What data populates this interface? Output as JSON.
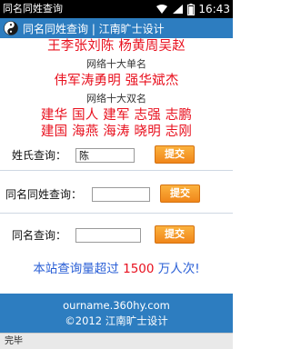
{
  "statusbar": {
    "app_title": "同名同姓查询",
    "time": "16:43",
    "icons": [
      "wifi-icon",
      "signal-icon",
      "battery-icon"
    ]
  },
  "header": {
    "logo_icon": "yin-yang-icon",
    "title": "同名同姓查询 | 江南旷士设计"
  },
  "names": {
    "top_single_partial": "王李张刘陈 杨黄周吴赵",
    "single_label": "网络十大单名",
    "single_names": "伟军涛勇明 强华斌杰",
    "double_label": "网络十大双名",
    "double_line1": "建华 国人 建军 志强 志鹏",
    "double_line2": "建国 海燕 海涛 晓明 志刚"
  },
  "queries": {
    "surname": {
      "label": "姓氏查询：",
      "value": "陈",
      "button": "提交"
    },
    "fullname": {
      "label": "同名同姓查询：",
      "value": "",
      "button": "提交"
    },
    "givenname": {
      "label": "同名查询：",
      "value": "",
      "button": "提交"
    }
  },
  "stats": {
    "prefix": "本站查询量超过 ",
    "number": "1500",
    "suffix": " 万人次!"
  },
  "footer": {
    "domain": "ourname.360hy.com",
    "copyright": "©2012 江南旷士设计"
  },
  "browser_status": "完毕",
  "colors": {
    "accent_blue": "#2d7dc0",
    "name_red": "#e8101e",
    "button_orange": "#f0861a",
    "stats_blue": "#2a5fd6"
  }
}
